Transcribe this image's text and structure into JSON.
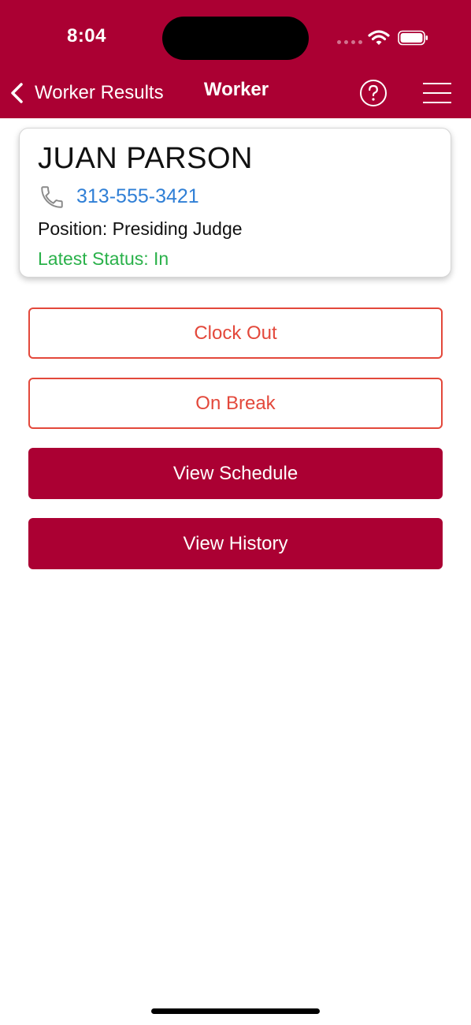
{
  "status_bar": {
    "time": "8:04"
  },
  "nav": {
    "back_label": "Worker Results",
    "title": "Worker",
    "help_icon": "question-circle-icon",
    "menu_icon": "hamburger-menu-icon"
  },
  "worker": {
    "name": "JUAN PARSON",
    "phone": "313-555-3421",
    "position_line": "Position: Presiding Judge",
    "status_line": "Latest Status: In"
  },
  "actions": {
    "clock_out": "Clock Out",
    "on_break": "On Break",
    "view_schedule": "View Schedule",
    "view_history": "View History"
  },
  "colors": {
    "brand": "#ab0033",
    "outline_accent": "#e3483b",
    "link": "#2f7fd6",
    "status_in": "#2ab14a"
  }
}
